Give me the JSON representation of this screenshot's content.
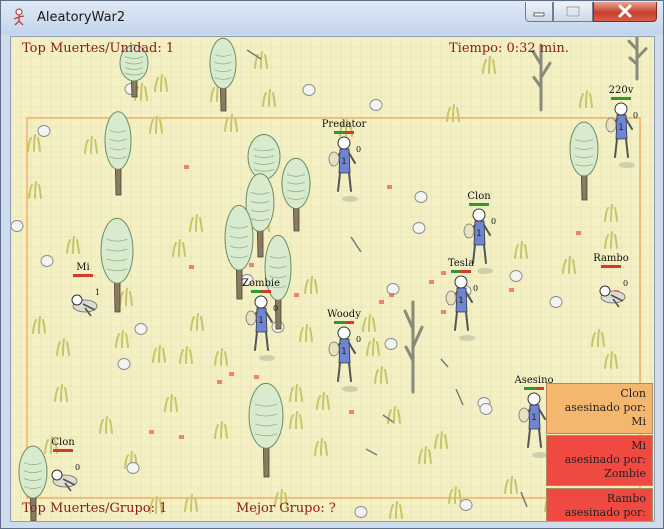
{
  "window": {
    "title": "AleatoryWar2",
    "app_icon": "stick-figure-icon",
    "controls": [
      "minimize-icon",
      "maximize-icon",
      "close-icon"
    ]
  },
  "hud": {
    "top_unit": "Top Muertes/Unidad: 1",
    "time": "Tiempo: 0:32 min.",
    "top_group": "Top Muertes/Grupo: 1",
    "best_group": "Mejor Grupo: ?"
  },
  "colors": {
    "field": "#f4f0c4",
    "grass": "#d8e4a8",
    "hud_text": "#8b1a12",
    "border_line": "#f0a050",
    "kill_orange": "#f5b76e",
    "kill_red": "#ee4a42",
    "hp_green": "#2e9a2e",
    "hp_red": "#d23a2a",
    "unit_blue": "#6e86d2"
  },
  "units": [
    {
      "name": "Predator",
      "level": "0",
      "hp": 0.6
    },
    {
      "name": "220v",
      "level": "0",
      "hp": 1.0
    },
    {
      "name": "Clon",
      "level": "0",
      "hp": 1.0
    },
    {
      "name": "Mi",
      "level": "1",
      "hp": 0.0
    },
    {
      "name": "Tesla",
      "level": "0",
      "hp": 0.4
    },
    {
      "name": "Rambo",
      "level": "0",
      "hp": 0.0
    },
    {
      "name": "Zombie",
      "level": "0",
      "hp": 0.5
    },
    {
      "name": "Woody",
      "level": "0",
      "hp": 0.6
    },
    {
      "name": "Asesino",
      "level": "0",
      "hp": 0.6
    },
    {
      "name": "Clon",
      "level": "0",
      "hp": 0.0
    }
  ],
  "kill_feed": [
    {
      "victim": "Clon",
      "text": "asesinado por:",
      "killer": "Mi",
      "color": "#f5b76e"
    },
    {
      "victim": "Mi",
      "text": "asesinado por:",
      "killer": "Zombie",
      "color": "#ee4a42"
    },
    {
      "victim": "Rambo",
      "text": "asesinado por:",
      "killer": "",
      "color": "#ee4a42"
    }
  ]
}
